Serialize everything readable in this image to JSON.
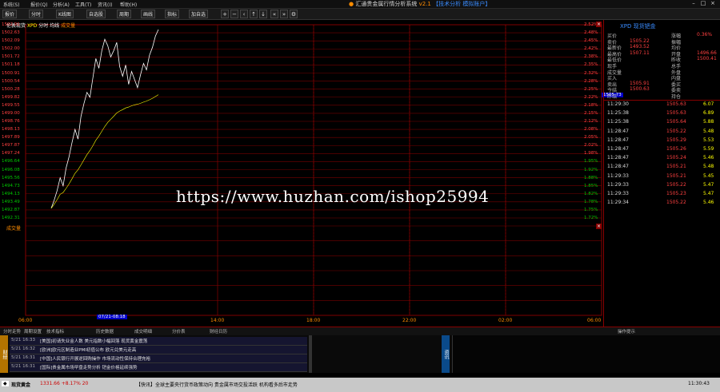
{
  "menubar": {
    "items": [
      "系统(S)",
      "报价(Q)",
      "分析(A)",
      "工具(T)",
      "资讯(I)",
      "帮助(H)"
    ],
    "title": "汇通贵金属行情分析系统",
    "version": "v2.1",
    "account": "【技术分析 模拟账户】"
  },
  "toolbar": {
    "buttons": [
      "报价",
      "分时",
      "K线图",
      "自选股",
      "周期",
      "画线",
      "指标",
      "加自选"
    ]
  },
  "chart": {
    "header_name": "伦敦现货",
    "header_code": "XPD",
    "header_mode": "分时 均线",
    "header_vol": "成交量",
    "volume_title": "成交量",
    "current_price": "1505.73",
    "left_ticks": [
      "1502.91",
      "1502.63",
      "1502.09",
      "1502.00",
      "1501.72",
      "1501.18",
      "1500.91",
      "1500.54",
      "1500.28",
      "1499.82",
      "1499.55",
      "1499.00",
      "1498.76",
      "1498.13",
      "1497.89",
      "1497.87",
      "1497.24",
      "1496.64",
      "1496.08",
      "1495.56",
      "1494.73",
      "1494.13",
      "1493.49",
      "1492.87",
      "1492.31"
    ],
    "right_ticks": [
      "2.52%",
      "2.48%",
      "2.45%",
      "2.42%",
      "2.38%",
      "2.35%",
      "2.32%",
      "2.28%",
      "2.25%",
      "2.22%",
      "2.18%",
      "2.15%",
      "2.12%",
      "2.08%",
      "2.05%",
      "2.02%",
      "1.98%",
      "1.95%",
      "1.92%",
      "1.88%",
      "1.85%",
      "1.82%",
      "1.78%",
      "1.75%",
      "1.72%"
    ],
    "x_ticks": [
      "06:00",
      "14:00",
      "18:00",
      "22:00",
      "02:00",
      "06:00"
    ],
    "cursor_time": "07/21-08:18",
    "price_series": [
      1492.1,
      1492.6,
      1493.2,
      1494.0,
      1493.5,
      1494.6,
      1495.3,
      1496.2,
      1497.0,
      1496.4,
      1497.8,
      1498.6,
      1499.3,
      1499.0,
      1500.2,
      1501.4,
      1500.8,
      1501.9,
      1502.6,
      1502.2,
      1501.5,
      1501.9,
      1502.4,
      1500.9,
      1500.3,
      1501.0,
      1499.8,
      1500.6,
      1500.1,
      1499.6,
      1500.4,
      1501.1,
      1500.7,
      1501.6,
      1502.1,
      1502.8,
      1503.2
    ]
  },
  "right_panel": {
    "title": "XPD 现货钯金",
    "quotes": [
      {
        "l": "买价",
        "v": "",
        "l2": "涨幅",
        "v2": "0.36%"
      },
      {
        "l": "卖价",
        "v": "1505.22",
        "l2": "振幅",
        "v2": ""
      },
      {
        "l": "最新价",
        "v": "1493.52",
        "l2": "均价",
        "v2": ""
      },
      {
        "l": "最高价",
        "v": "1507.11",
        "l2": "开盘",
        "v2": "1496.66"
      },
      {
        "l": "最低价",
        "v": "",
        "l2": "昨收",
        "v2": "1500.41"
      },
      {
        "l": "现手",
        "v": "",
        "l2": "总手",
        "v2": ""
      },
      {
        "l": "成交量",
        "v": "",
        "l2": "外盘",
        "v2": ""
      },
      {
        "l": "买入",
        "v": "",
        "l2": "内盘",
        "v2": ""
      },
      {
        "l": "卖出",
        "v": "1505.91",
        "l2": "委买",
        "v2": ""
      },
      {
        "l": "今结",
        "v": "1500.63",
        "l2": "委卖",
        "v2": ""
      },
      {
        "l": "昨结",
        "v": "",
        "l2": "持仓",
        "v2": ""
      }
    ],
    "ticks": [
      {
        "t": "11:29:30",
        "p": "1505.63",
        "v": "6.07"
      },
      {
        "t": "11:25:38",
        "p": "1505.63",
        "v": "6.89"
      },
      {
        "t": "11:25:38",
        "p": "1505.64",
        "v": "5.88"
      },
      {
        "t": "11:28:47",
        "p": "1505.22",
        "v": "5.48"
      },
      {
        "t": "11:28:47",
        "p": "1505.29",
        "v": "5.53"
      },
      {
        "t": "11:28:47",
        "p": "1505.26",
        "v": "5.59"
      },
      {
        "t": "11:28:47",
        "p": "1505.24",
        "v": "5.46"
      },
      {
        "t": "11:28:47",
        "p": "1505.21",
        "v": "5.48"
      },
      {
        "t": "11:29:33",
        "p": "1505.21",
        "v": "5.45"
      },
      {
        "t": "11:29:33",
        "p": "1505.22",
        "v": "5.47"
      },
      {
        "t": "11:29:33",
        "p": "1505.23",
        "v": "5.47"
      },
      {
        "t": "11:29:34",
        "p": "1505.22",
        "v": "5.46"
      }
    ]
  },
  "bottom_tabs": [
    "分时走势",
    "周期设置",
    "技术指标",
    "历史数据",
    "成交明细",
    "分价表",
    "财经日历",
    "操作提示"
  ],
  "news": {
    "side_left": "财经",
    "side_right": "资讯",
    "items": [
      {
        "time": "5/21 16:33",
        "text": "[美国]初请失业金人数 美元指数小幅回落 现货黄金震荡"
      },
      {
        "time": "5/21 16:32",
        "text": "[欧洲]欧元区制造业PMI初值公布 欧元兑美元走高"
      },
      {
        "time": "5/21 16:31",
        "text": "[中国]人民银行开展逆回购操作 市场流动性保持合理充裕"
      },
      {
        "time": "5/21 16:31",
        "text": "[国际]贵金属市场早盘走势分析 钯金价格延续强势"
      }
    ]
  },
  "status": {
    "label": "现货黄金",
    "price": "1331.66 +8.17% 20",
    "news_ticker": "【快讯】全球主要央行货币政策动向 贵金属市场交投活跃 机构看多后市走势",
    "time": "11:30:43"
  },
  "watermark": "https://www.huzhan.com/ishop25994"
}
